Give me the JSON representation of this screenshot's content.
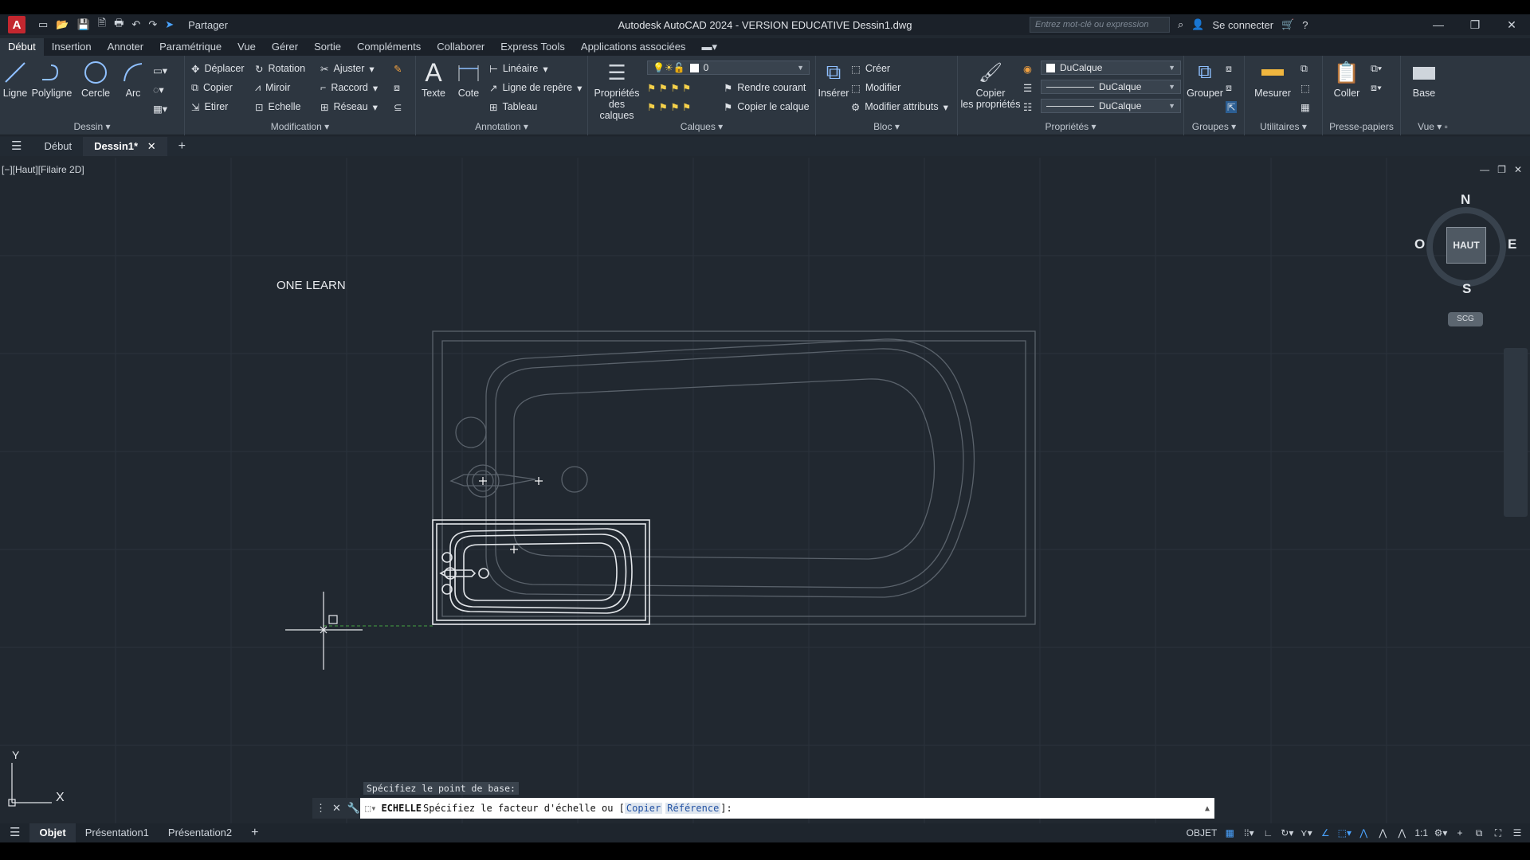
{
  "app": {
    "title": "Autodesk AutoCAD 2024 - VERSION EDUCATIVE    Dessin1.dwg",
    "logo": "A",
    "share_label": "Partager",
    "search_placeholder": "Entrez mot-clé ou expression",
    "signin": "Se connecter"
  },
  "ribbon_tabs": [
    "Début",
    "Insertion",
    "Annoter",
    "Paramétrique",
    "Vue",
    "Gérer",
    "Sortie",
    "Compléments",
    "Collaborer",
    "Express Tools",
    "Applications associées"
  ],
  "ribbon": {
    "dessin": {
      "title": "Dessin",
      "ligne": "Ligne",
      "polyligne": "Polyligne",
      "cercle": "Cercle",
      "arc": "Arc"
    },
    "modification": {
      "title": "Modification",
      "deplacer": "Déplacer",
      "rotation": "Rotation",
      "ajuster": "Ajuster",
      "copier": "Copier",
      "miroir": "Miroir",
      "raccord": "Raccord",
      "etirer": "Etirer",
      "echelle": "Echelle",
      "reseau": "Réseau"
    },
    "annotation": {
      "title": "Annotation",
      "texte": "Texte",
      "cote": "Cote",
      "lineaire": "Linéaire",
      "ligne_repere": "Ligne de repère",
      "tableau": "Tableau"
    },
    "calques": {
      "title": "Calques",
      "proprietes_1": "Propriétés",
      "proprietes_2": "des calques",
      "layer_value": "0",
      "rendre_courant": "Rendre courant",
      "copier_calque": "Copier le calque"
    },
    "bloc": {
      "title": "Bloc",
      "inserer": "Insérer",
      "creer": "Créer",
      "modifier": "Modifier",
      "modifier_attributs": "Modifier attributs"
    },
    "proprietes": {
      "title": "Propriétés",
      "copier_1": "Copier",
      "copier_2": "les propriétés",
      "color": "DuCalque",
      "linetype": "DuCalque",
      "lineweight": "DuCalque"
    },
    "groupes": {
      "title": "Groupes",
      "grouper": "Grouper"
    },
    "utilitaires": {
      "title": "Utilitaires",
      "mesurer": "Mesurer"
    },
    "presse_papiers": {
      "title": "Presse-papiers",
      "coller": "Coller"
    },
    "vue": {
      "title": "Vue",
      "base": "Base"
    }
  },
  "doc_tabs": {
    "start": "Début",
    "current": "Dessin1*"
  },
  "viewport": {
    "label": "[−][Haut][Filaire 2D]",
    "annotation_text": "ONE LEARN",
    "viewcube": {
      "face": "HAUT",
      "north": "N",
      "south": "S",
      "east": "E",
      "west": "O"
    },
    "ucs": {
      "x": "X",
      "y": "Y"
    },
    "scg": "SCG"
  },
  "command": {
    "history": "Spécifiez le point de base:",
    "name": "ECHELLE",
    "prompt": "Spécifiez le facteur d'échelle ou [",
    "option1": "Copier",
    "option2": "Référence",
    "suffix": "]:"
  },
  "layout_tabs": [
    "Objet",
    "Présentation1",
    "Présentation2"
  ],
  "status": {
    "mode": "OBJET",
    "scale": "1:1"
  },
  "colors": {
    "canvas": "#212830",
    "ribbon": "#2d3640",
    "geometry": "#d9dde2",
    "accent": "#4aa3ff"
  }
}
